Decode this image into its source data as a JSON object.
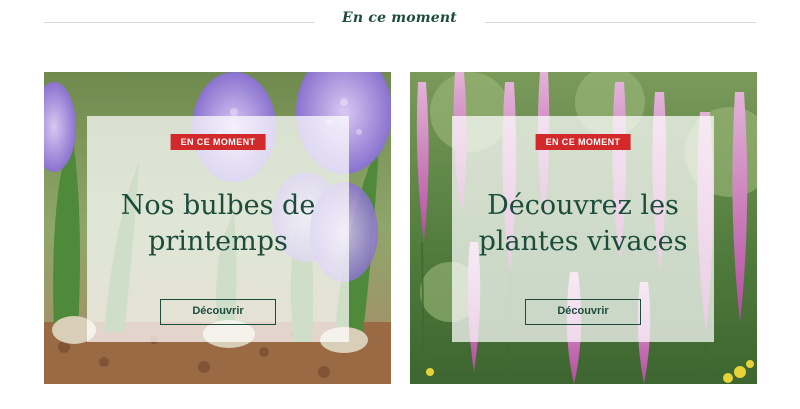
{
  "section": {
    "title": "En ce moment"
  },
  "cards": [
    {
      "badge": "EN CE MOMENT",
      "title_line1": "Nos bulbes de",
      "title_line2": "printemps",
      "button": "Découvrir"
    },
    {
      "badge": "EN CE MOMENT",
      "title_line1": "Découvrez les",
      "title_line2": "plantes vivaces",
      "button": "Découvrir"
    }
  ],
  "colors": {
    "brand_green": "#1c4d3c",
    "badge_red": "#d2292b",
    "divider": "#d6d6d6"
  }
}
